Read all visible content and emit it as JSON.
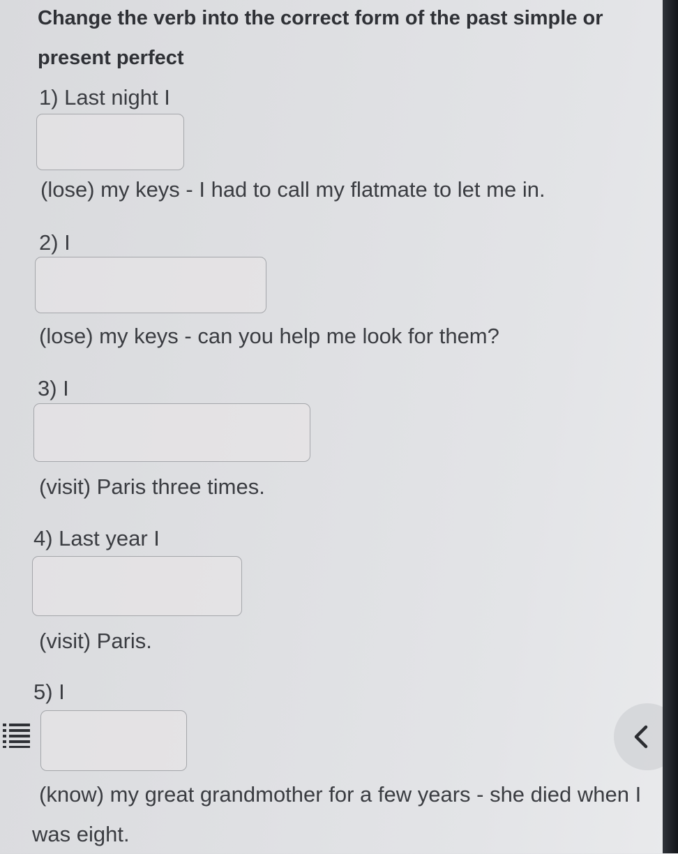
{
  "exercise": {
    "title": "Change the verb into the correct form of the past simple or present perfect",
    "questions": [
      {
        "label": "1) Last night I",
        "answer": "",
        "after": "(lose) my keys - I had to call my flatmate to let me in."
      },
      {
        "label": "2) I",
        "answer": "",
        "after": "(lose) my keys - can you help me look for them?"
      },
      {
        "label": "3) I",
        "answer": "",
        "after": "(visit) Paris three times."
      },
      {
        "label": "4) Last year I",
        "answer": "",
        "after": "(visit) Paris."
      },
      {
        "label": "5) I",
        "answer": "",
        "after": "(know) my great grandmother for a few years - she died when I was eight."
      }
    ]
  },
  "controls": {
    "list_icon": "list-icon",
    "back_icon": "chevron-left-icon"
  },
  "colors": {
    "text": "#3a3c41",
    "box_border": "#a4a6aa",
    "background": "#dedfe2"
  }
}
